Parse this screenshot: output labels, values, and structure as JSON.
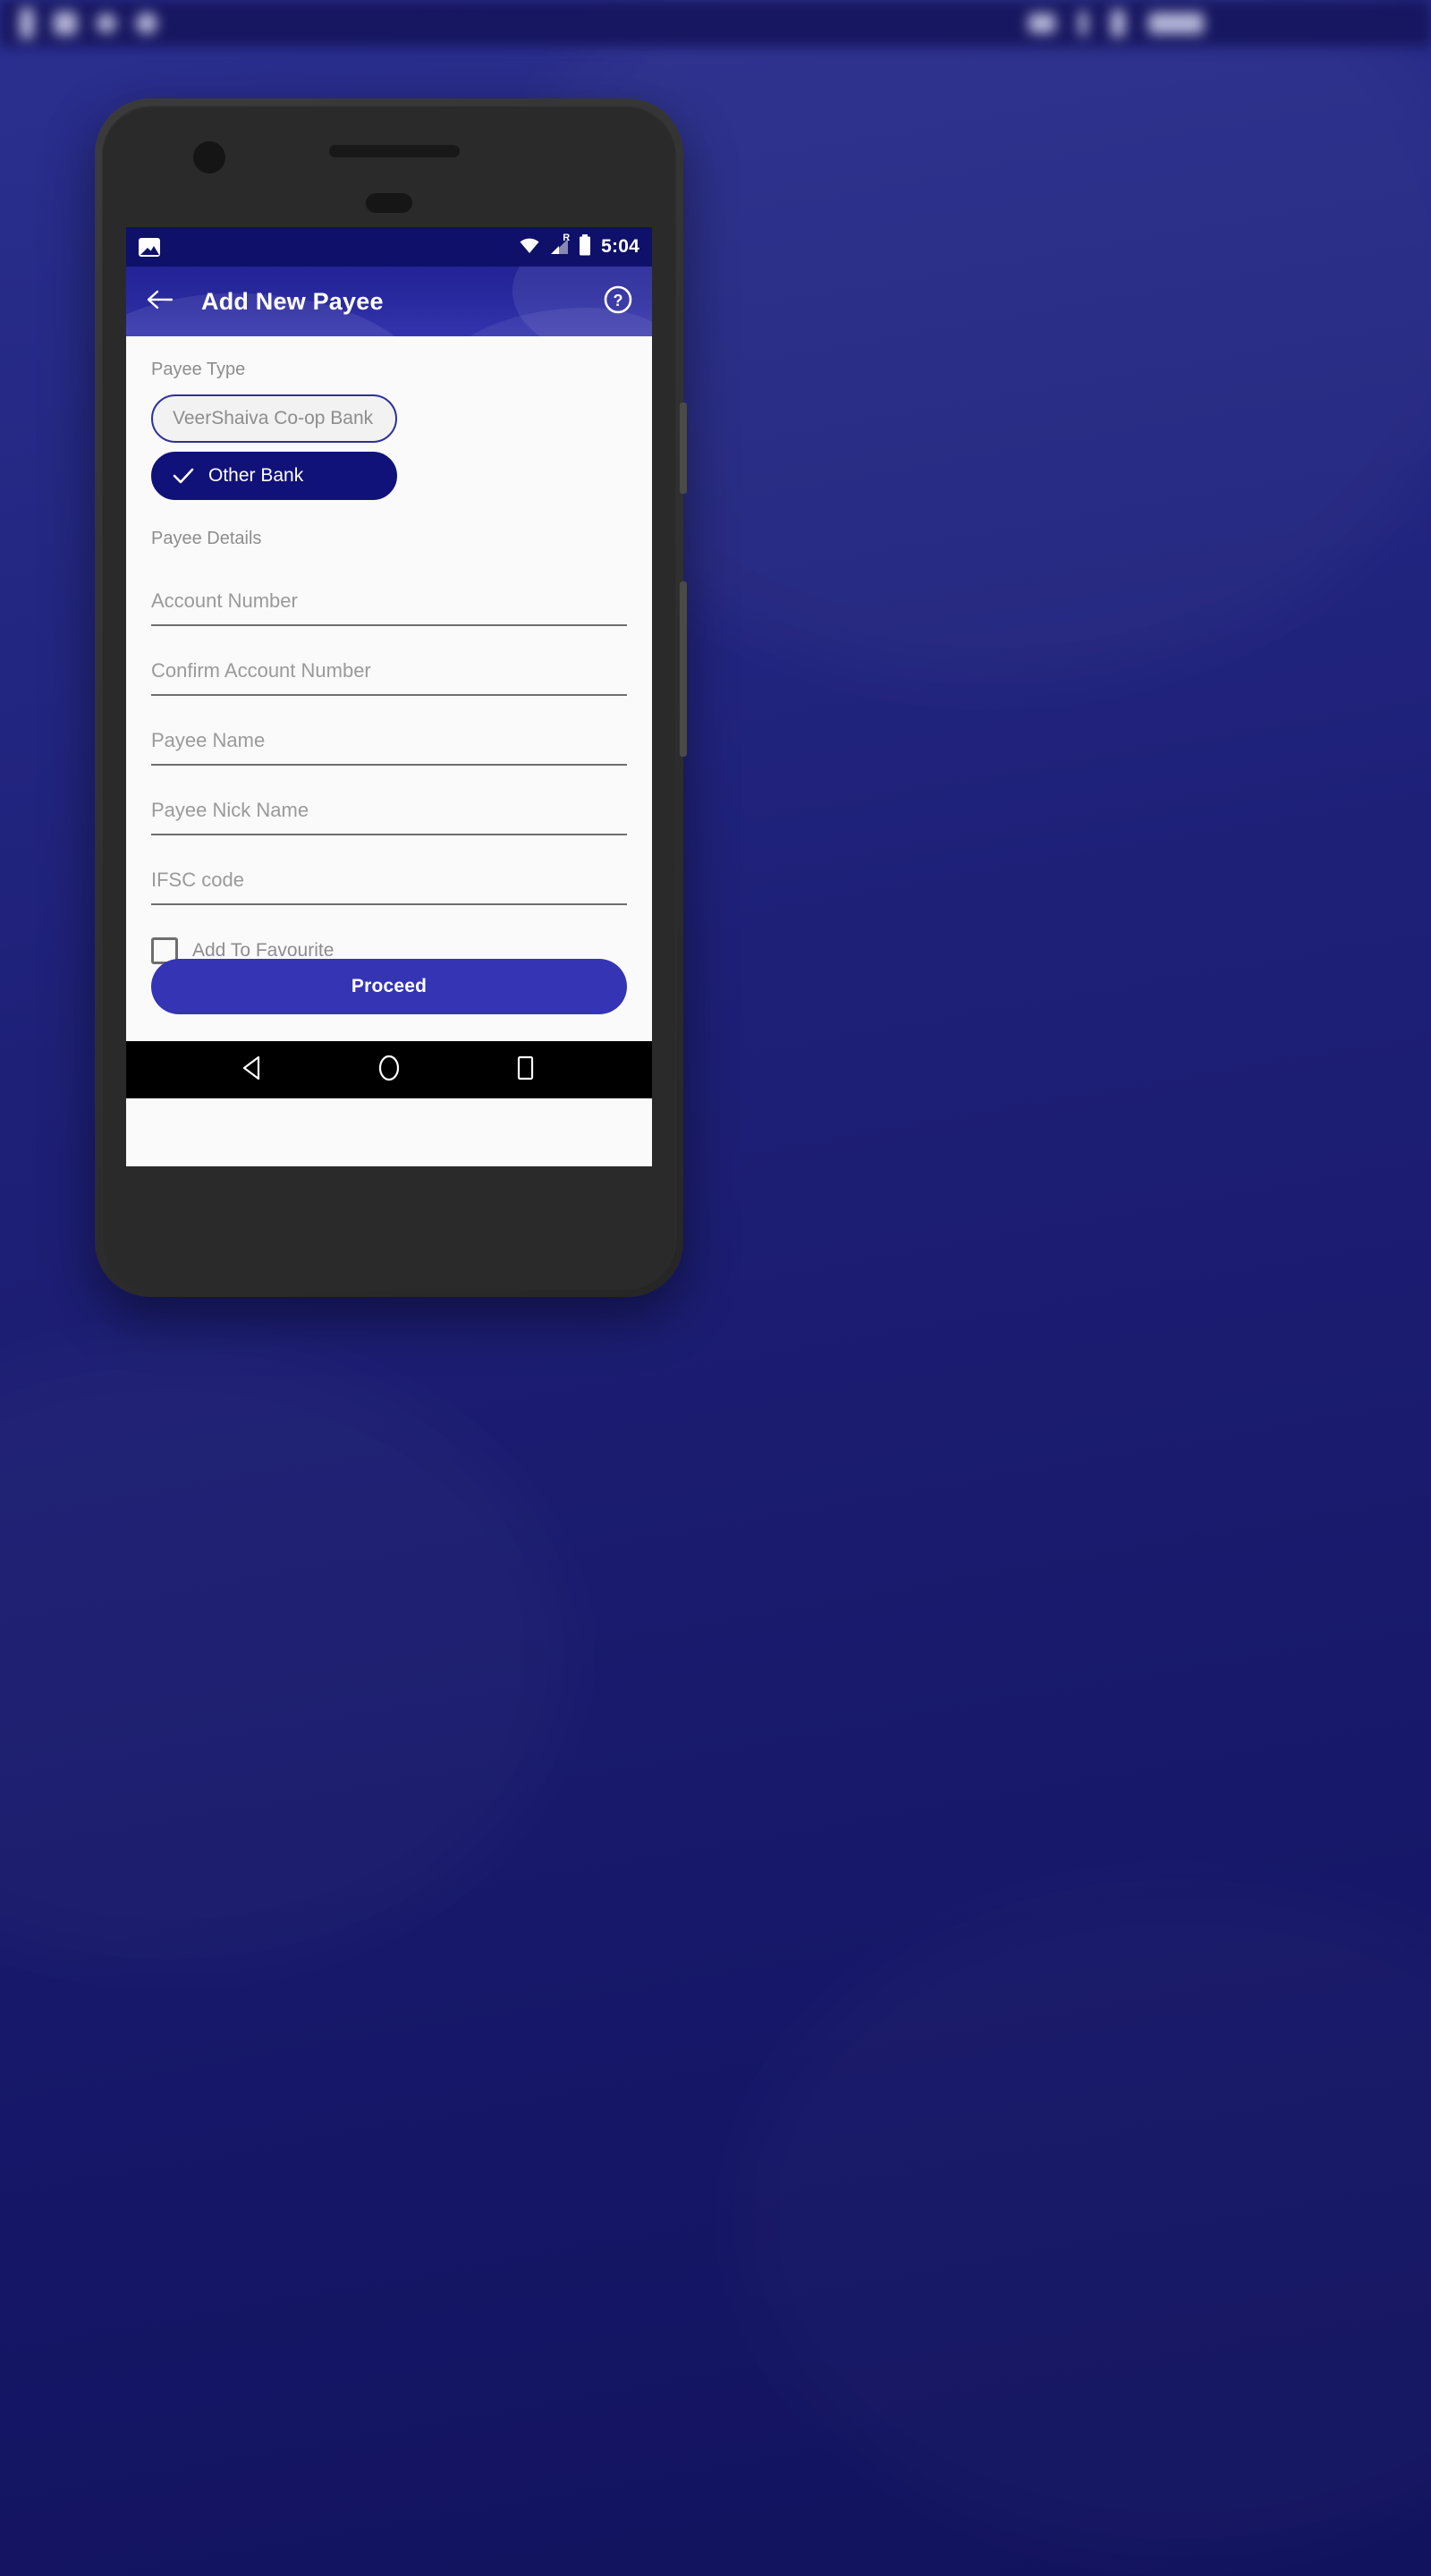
{
  "os_statusbar": {
    "blurred": true,
    "background_color": "#171660"
  },
  "wallpaper": {
    "gradient_from": "#2b2f8f",
    "gradient_to": "#12135e"
  },
  "device": {
    "frame_color": "#333333",
    "camera_icon": "camera-dot",
    "earpiece_icon": "earpiece-speaker",
    "sensor_icon": "proximity-sensor"
  },
  "app_statusbar": {
    "background_color": "#0f1069",
    "notification_icon": "photo-icon",
    "wifi_icon": "wifi-icon",
    "signal_icon": "signal-roaming-icon",
    "roaming_label": "R",
    "battery_icon": "battery-full-icon",
    "time": "5:04"
  },
  "app_bar": {
    "background_color": "#2a2aa0",
    "back_icon": "back-arrow-icon",
    "title": "Add New Payee",
    "help_icon": "help-circle-icon"
  },
  "form": {
    "payee_type_label": "Payee Type",
    "payee_type_options": [
      {
        "label": "VeerShaiva Co-op Bank",
        "selected": false
      },
      {
        "label": "Other Bank",
        "selected": true
      }
    ],
    "payee_details_label": "Payee Details",
    "fields": [
      {
        "name": "account-number",
        "placeholder": "Account Number",
        "value": ""
      },
      {
        "name": "confirm-account-number",
        "placeholder": "Confirm Account Number",
        "value": ""
      },
      {
        "name": "payee-name",
        "placeholder": "Payee Name",
        "value": ""
      },
      {
        "name": "payee-nick-name",
        "placeholder": "Payee Nick Name",
        "value": ""
      },
      {
        "name": "ifsc-code",
        "placeholder": "IFSC code",
        "value": ""
      }
    ],
    "favourite_checkbox": {
      "label": "Add To Favourite",
      "checked": false
    },
    "submit_label": "Proceed",
    "submit_color": "#3434b5"
  },
  "nav_bar": {
    "background_color": "#000000",
    "back_icon": "nav-back-triangle-icon",
    "home_icon": "nav-home-circle-icon",
    "recents_icon": "nav-recents-square-icon"
  }
}
